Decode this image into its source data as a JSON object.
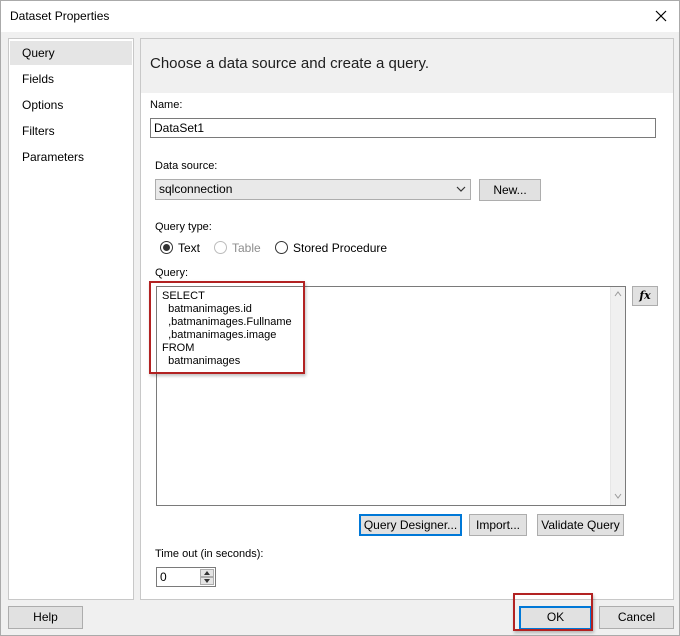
{
  "window": {
    "title": "Dataset Properties"
  },
  "sidebar": {
    "items": [
      {
        "label": "Query",
        "selected": true
      },
      {
        "label": "Fields"
      },
      {
        "label": "Options"
      },
      {
        "label": "Filters"
      },
      {
        "label": "Parameters"
      }
    ]
  },
  "content": {
    "header": "Choose a data source and create a query.",
    "name": {
      "label": "Name:",
      "value": "DataSet1"
    },
    "data_source": {
      "label": "Data source:",
      "value": "sqlconnection",
      "new_button": "New..."
    },
    "query_type": {
      "label": "Query type:",
      "options": [
        {
          "label": "Text",
          "checked": true
        },
        {
          "label": "Table",
          "disabled": true
        },
        {
          "label": "Stored Procedure"
        }
      ]
    },
    "query": {
      "label": "Query:",
      "lines": [
        "SELECT",
        "  batmanimages.id",
        "  ,batmanimages.Fullname",
        "  ,batmanimages.image",
        "FROM",
        "  batmanimages"
      ],
      "fx_button": "fx"
    },
    "buttons": {
      "query_designer": "Query Designer...",
      "import": "Import...",
      "validate": "Validate Query"
    },
    "timeout": {
      "label": "Time out (in seconds):",
      "value": "0"
    }
  },
  "footer": {
    "help": "Help",
    "ok": "OK",
    "cancel": "Cancel"
  },
  "colors": {
    "highlight": "#b22222",
    "focus": "#0078d7"
  }
}
